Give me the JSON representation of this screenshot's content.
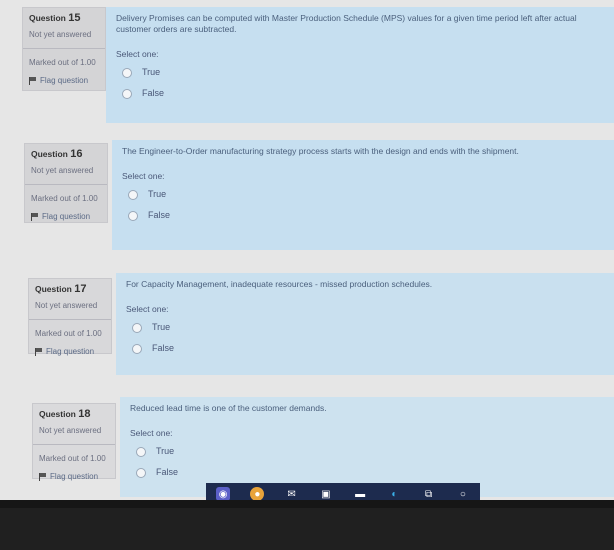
{
  "questions": [
    {
      "label": "Question",
      "number": "15",
      "status": "Not yet answered",
      "marks": "Marked out of 1.00",
      "flag": "Flag question",
      "prompt": "Delivery Promises can be computed with Master Production Schedule (MPS) values for a given time period left after actual customer orders are subtracted.",
      "select": "Select one:",
      "options": [
        "True",
        "False"
      ]
    },
    {
      "label": "Question",
      "number": "16",
      "status": "Not yet answered",
      "marks": "Marked out of 1.00",
      "flag": "Flag question",
      "prompt": "The Engineer-to-Order manufacturing strategy process starts with the design and ends with the shipment.",
      "select": "Select one:",
      "options": [
        "True",
        "False"
      ]
    },
    {
      "label": "Question",
      "number": "17",
      "status": "Not yet answered",
      "marks": "Marked out of 1.00",
      "flag": "Flag question",
      "prompt": "For Capacity Management, inadequate resources - missed production schedules.",
      "select": "Select one:",
      "options": [
        "True",
        "False"
      ]
    },
    {
      "label": "Question",
      "number": "18",
      "status": "Not yet answered",
      "marks": "Marked out of 1.00",
      "flag": "Flag question",
      "prompt": "Reduced lead time is one of the customer demands.",
      "select": "Select one:",
      "options": [
        "True",
        "False"
      ]
    }
  ],
  "taskbar": {
    "icons": [
      "teams-icon",
      "chrome-icon",
      "mail-icon",
      "store-icon",
      "photos-icon",
      "edge-icon",
      "task-view-icon",
      "search-circle-icon"
    ],
    "colors": {
      "bar": "#1d2b4e"
    }
  },
  "colors": {
    "question_bg": "#c6dff0",
    "info_bg": "#d4d4d6",
    "text": "#4a5f7c"
  }
}
